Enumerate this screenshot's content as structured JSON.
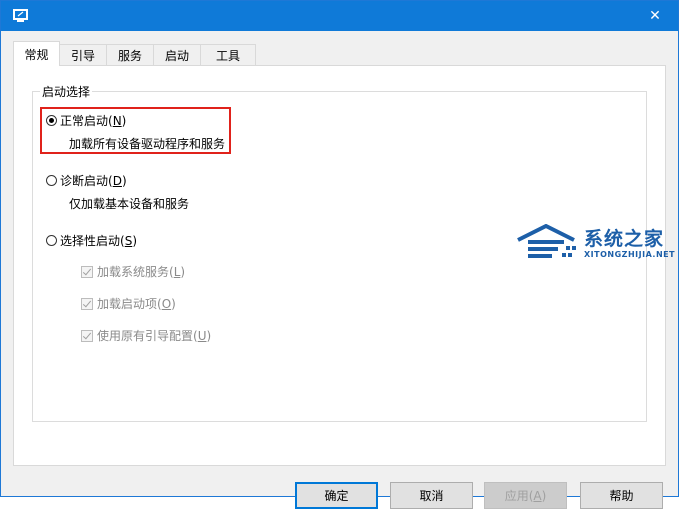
{
  "window": {
    "close_glyph": "✕"
  },
  "tabs": [
    {
      "label": "常规",
      "active": true
    },
    {
      "label": "引导",
      "active": false
    },
    {
      "label": "服务",
      "active": false
    },
    {
      "label": "启动",
      "active": false
    },
    {
      "label": "工具",
      "active": false
    }
  ],
  "startup_group": {
    "legend": "启动选择",
    "normal": {
      "label_prefix": "正常启动(",
      "accel": "N",
      "label_suffix": ")",
      "description": "加载所有设备驱动程序和服务",
      "checked": true
    },
    "diagnostic": {
      "label_prefix": "诊断启动(",
      "accel": "D",
      "label_suffix": ")",
      "description": "仅加载基本设备和服务",
      "checked": false
    },
    "selective": {
      "label_prefix": "选择性启动(",
      "accel": "S",
      "label_suffix": ")",
      "checked": false,
      "options": [
        {
          "prefix": "加载系统服务(",
          "accel": "L",
          "suffix": ")",
          "checked": true,
          "enabled": false
        },
        {
          "prefix": "加载启动项(",
          "accel": "O",
          "suffix": ")",
          "checked": true,
          "enabled": false
        },
        {
          "prefix": "使用原有引导配置(",
          "accel": "U",
          "suffix": ")",
          "checked": true,
          "enabled": false
        }
      ]
    }
  },
  "buttons": {
    "ok": "确定",
    "cancel": "取消",
    "apply_prefix": "应用(",
    "apply_accel": "A",
    "apply_suffix": ")",
    "help": "帮助"
  },
  "watermark": {
    "title": "系统之家",
    "subtitle": "XITONGZHIJIA.NET"
  },
  "colors": {
    "titlebar": "#0f7ad8",
    "highlight": "#e0221b",
    "default_button_border": "#0078d7",
    "watermark": "#1d5fa8"
  }
}
